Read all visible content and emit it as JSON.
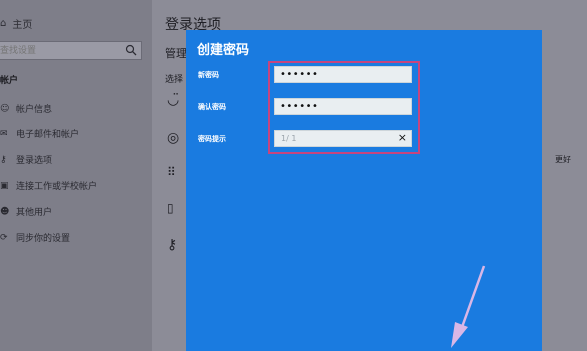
{
  "sidebar": {
    "home_label": "主页",
    "search_placeholder": "查找设置",
    "section_title": "帐户",
    "items": [
      {
        "label": "帐户信息",
        "icon": "person-icon"
      },
      {
        "label": "电子邮件和帐户",
        "icon": "mail-icon"
      },
      {
        "label": "登录选项",
        "icon": "key-icon"
      },
      {
        "label": "连接工作或学校帐户",
        "icon": "briefcase-icon"
      },
      {
        "label": "其他用户",
        "icon": "people-icon"
      },
      {
        "label": "同步你的设置",
        "icon": "sync-icon"
      }
    ]
  },
  "main": {
    "title": "登录选项",
    "manage_text": "管理",
    "choose_text": "选择",
    "side_text": "更好"
  },
  "dialog": {
    "title": "创建密码",
    "new_password_label": "新密码",
    "new_password_value": "••••••",
    "confirm_password_label": "确认密码",
    "confirm_password_value": "••••••",
    "hint_label": "密码提示",
    "hint_value": "1/ 1"
  },
  "colors": {
    "dialog_bg": "#1a7be0",
    "highlight_border": "#c7457e",
    "arrow": "#d9b7e6"
  }
}
